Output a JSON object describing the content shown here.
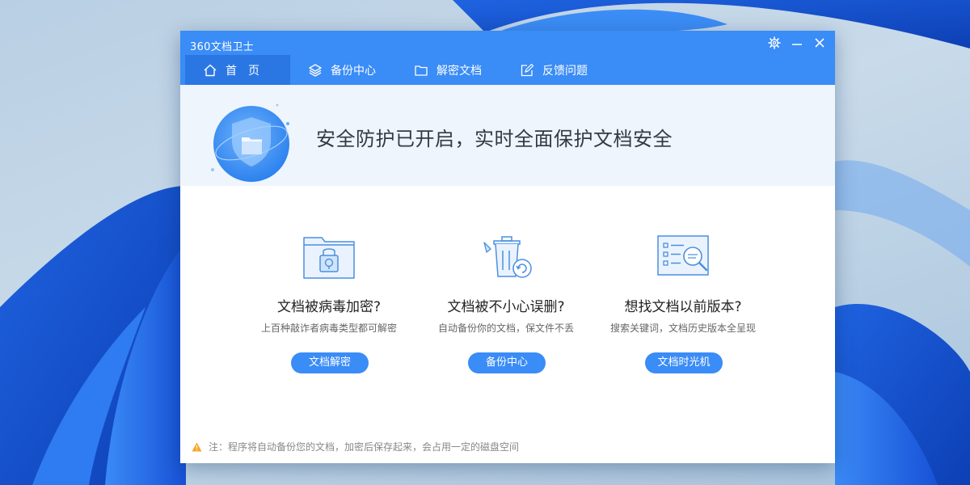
{
  "window": {
    "title": "360文档卫士"
  },
  "tabs": [
    {
      "label": "首页"
    },
    {
      "label": "备份中心"
    },
    {
      "label": "解密文档"
    },
    {
      "label": "反馈问题"
    }
  ],
  "banner": {
    "title": "安全防护已开启，实时全面保护文档安全"
  },
  "features": [
    {
      "title": "文档被病毒加密?",
      "desc": "上百种敲诈者病毒类型都可解密",
      "button": "文档解密"
    },
    {
      "title": "文档被不小心误删?",
      "desc": "自动备份你的文档，保文件不丢",
      "button": "备份中心"
    },
    {
      "title": "想找文档以前版本?",
      "desc": "搜索关键词，文档历史版本全呈现",
      "button": "文档时光机"
    }
  ],
  "footer": {
    "note": "注：程序将自动备份您的文档，加密后保存起来，会占用一定的磁盘空间"
  },
  "colors": {
    "accent": "#3a8cf6",
    "active_tab": "#2a77e4",
    "banner_bg": "#eef5fc",
    "warning": "#f5a623"
  },
  "icons": {
    "settings": "gear-icon",
    "minimize": "minimize-icon",
    "close": "close-icon",
    "home": "home-icon",
    "backup": "layers-icon",
    "decrypt": "folder-icon",
    "feedback": "edit-icon",
    "shield": "shield-folder-icon",
    "feature1": "locked-folder-icon",
    "feature2": "trash-restore-icon",
    "feature3": "document-search-icon",
    "warning": "warning-icon"
  }
}
